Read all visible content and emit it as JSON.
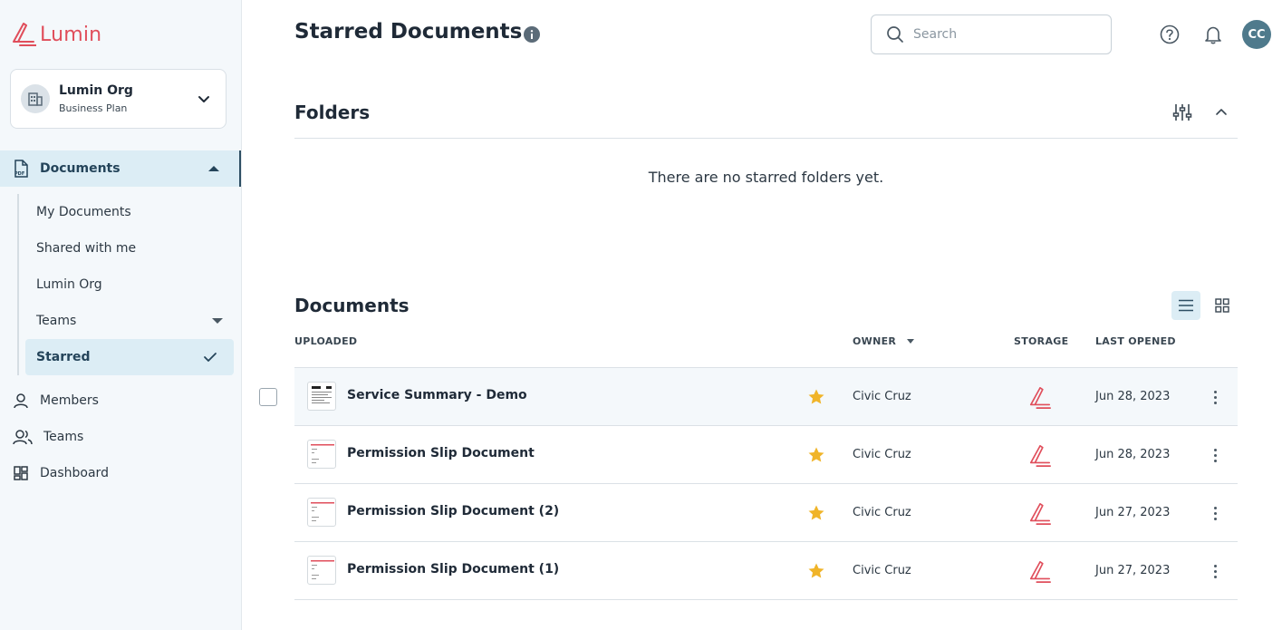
{
  "brand": {
    "name": "Lumin",
    "accent": "#e04e5b"
  },
  "org": {
    "name": "Lumin Org",
    "plan": "Business Plan"
  },
  "sidebar": {
    "documents_label": "Documents",
    "sub_items": [
      "My Documents",
      "Shared with me",
      "Lumin Org",
      "Teams",
      "Starred"
    ],
    "active_sub_item": "Starred",
    "items": [
      "Members",
      "Teams",
      "Dashboard"
    ]
  },
  "header": {
    "title": "Starred Documents",
    "search_placeholder": "Search",
    "avatar_initials": "CC"
  },
  "folders": {
    "title": "Folders",
    "empty_message": "There are no starred folders yet."
  },
  "documents": {
    "title": "Documents",
    "columns": {
      "uploaded": "UPLOADED",
      "owner": "OWNER",
      "storage": "STORAGE",
      "last_opened": "LAST OPENED"
    },
    "rows": [
      {
        "name": "Service Summary - Demo",
        "owner": "Civic Cruz",
        "last_opened": "Jun 28, 2023",
        "starred": true,
        "storage": "lumin-icon"
      },
      {
        "name": "Permission Slip Document",
        "owner": "Civic Cruz",
        "last_opened": "Jun 28, 2023",
        "starred": true,
        "storage": "lumin-icon"
      },
      {
        "name": "Permission Slip Document (2)",
        "owner": "Civic Cruz",
        "last_opened": "Jun 27, 2023",
        "starred": true,
        "storage": "lumin-icon"
      },
      {
        "name": "Permission Slip Document (1)",
        "owner": "Civic Cruz",
        "last_opened": "Jun 27, 2023",
        "starred": true,
        "storage": "lumin-icon"
      }
    ]
  },
  "colors": {
    "sidebar_bg": "#f4f8fb",
    "active_bg": "#dcedf5",
    "star": "#f0b429",
    "avatar": "#4f7a8c"
  }
}
